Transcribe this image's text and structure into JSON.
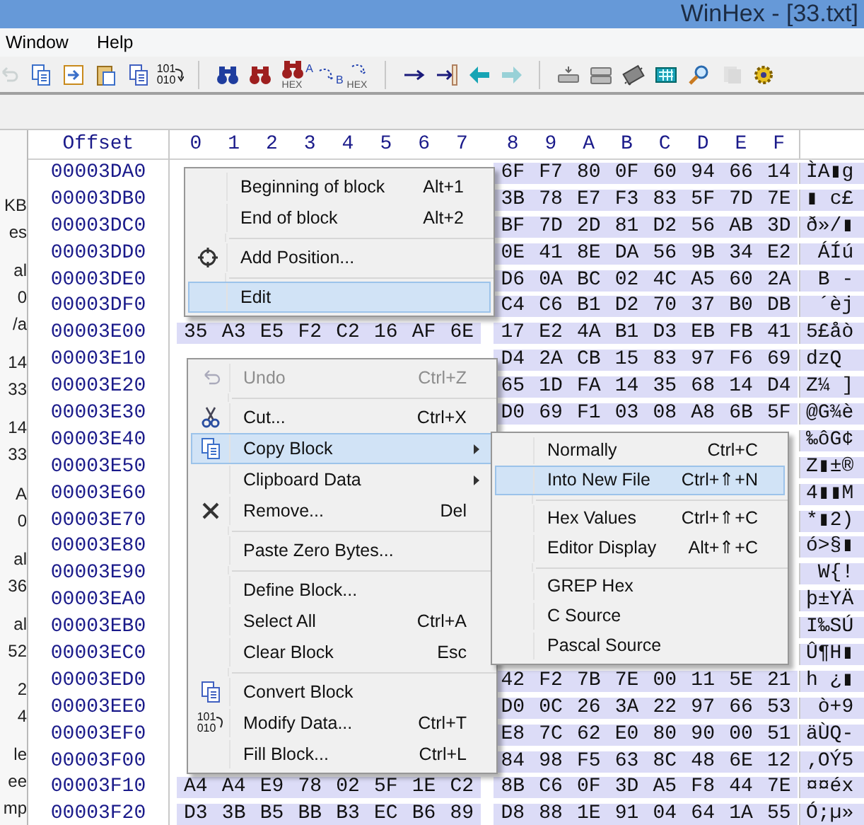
{
  "window": {
    "title": "WinHex - [33.txt]"
  },
  "menu_bar": [
    "Window",
    "Help"
  ],
  "toolbar": [
    {
      "tools": [
        {
          "kind": "undo",
          "disabled": true
        },
        {
          "kind": "copy",
          "disabled": false
        },
        {
          "kind": "paste",
          "disabled": false
        },
        {
          "kind": "clipboard",
          "disabled": false
        },
        {
          "kind": "convert",
          "disabled": false
        },
        {
          "kind": "bits",
          "disabled": false,
          "caption": [
            "101",
            "010"
          ]
        }
      ]
    },
    {
      "tools": [
        {
          "kind": "find",
          "disabled": false
        },
        {
          "kind": "find-red",
          "disabled": false
        },
        {
          "kind": "find-hex",
          "disabled": false,
          "caption": [
            "HEX"
          ]
        },
        {
          "kind": "replace",
          "disabled": false,
          "caption": [
            "A",
            "B"
          ]
        },
        {
          "kind": "replace-hex",
          "disabled": false,
          "caption": [
            "HEX"
          ]
        }
      ]
    },
    {
      "tools": [
        {
          "kind": "goto",
          "disabled": false
        },
        {
          "kind": "goto-mark",
          "disabled": false
        },
        {
          "kind": "back",
          "disabled": false
        },
        {
          "kind": "forward",
          "disabled": true
        }
      ]
    },
    {
      "tools": [
        {
          "kind": "disk",
          "disabled": false
        },
        {
          "kind": "disks",
          "disabled": false
        },
        {
          "kind": "chip",
          "disabled": false
        },
        {
          "kind": "calc",
          "disabled": false
        },
        {
          "kind": "zoom",
          "disabled": false
        },
        {
          "kind": "cards",
          "disabled": true
        },
        {
          "kind": "gear",
          "disabled": false
        }
      ]
    }
  ],
  "side_panel": [
    [
      "KB",
      "es"
    ],
    [
      "al",
      "0",
      "/a"
    ],
    [
      "14",
      "33"
    ],
    [
      "14",
      "33"
    ],
    [
      "A",
      "0"
    ],
    [
      "al",
      "36"
    ],
    [
      "al",
      "52"
    ],
    [
      "2",
      "4"
    ],
    [
      "le",
      "ee",
      "mp"
    ]
  ],
  "grid": {
    "offset_header": "Offset",
    "columns": [
      "0",
      "1",
      "2",
      "3",
      "4",
      "5",
      "6",
      "7",
      "8",
      "9",
      "A",
      "B",
      "C",
      "D",
      "E",
      "F"
    ],
    "rows": [
      {
        "offset": "00003DA0",
        "high": [
          "6F",
          "F7",
          "80",
          "0F",
          "60",
          "94",
          "66",
          "14"
        ],
        "text": "ÌA▮g"
      },
      {
        "offset": "00003DB0",
        "high": [
          "3B",
          "78",
          "E7",
          "F3",
          "83",
          "5F",
          "7D",
          "7E"
        ],
        "text": "▮ c£"
      },
      {
        "offset": "00003DC0",
        "high": [
          "BF",
          "7D",
          "2D",
          "81",
          "D2",
          "56",
          "AB",
          "3D"
        ],
        "text": "ð»/▮"
      },
      {
        "offset": "00003DD0",
        "high": [
          "0E",
          "41",
          "8E",
          "DA",
          "56",
          "9B",
          "34",
          "E2"
        ],
        "text": " ÁÍú"
      },
      {
        "offset": "00003DE0",
        "high": [
          "D6",
          "0A",
          "BC",
          "02",
          "4C",
          "A5",
          "60",
          "2A"
        ],
        "text": " B -"
      },
      {
        "offset": "00003DF0",
        "high": [
          "C4",
          "C6",
          "B1",
          "D2",
          "70",
          "37",
          "B0",
          "DB"
        ],
        "text": " ´èj"
      },
      {
        "offset": "00003E00",
        "low": [
          "35",
          "A3",
          "E5",
          "F2",
          "C2",
          "16",
          "AF",
          "6E"
        ],
        "high": [
          "17",
          "E2",
          "4A",
          "B1",
          "D3",
          "EB",
          "FB",
          "41"
        ],
        "text": "5£åò"
      },
      {
        "offset": "00003E10",
        "high": [
          "D4",
          "2A",
          "CB",
          "15",
          "83",
          "97",
          "F6",
          "69"
        ],
        "text": "dzQ"
      },
      {
        "offset": "00003E20",
        "high": [
          "65",
          "1D",
          "FA",
          "14",
          "35",
          "68",
          "14",
          "D4"
        ],
        "text": "Z¼ ]"
      },
      {
        "offset": "00003E30",
        "high": [
          "D0",
          "69",
          "F1",
          "03",
          "08",
          "A8",
          "6B",
          "5F"
        ],
        "text": "@G¾è"
      },
      {
        "offset": "00003E40",
        "text": "‰ôG¢"
      },
      {
        "offset": "00003E50",
        "text": "Z▮±®"
      },
      {
        "offset": "00003E60",
        "text": "4▮▮M"
      },
      {
        "offset": "00003E70",
        "text": "*▮2)"
      },
      {
        "offset": "00003E80",
        "text": "ó>§▮"
      },
      {
        "offset": "00003E90",
        "text": " W{!"
      },
      {
        "offset": "00003EA0",
        "text": "þ±YÄ"
      },
      {
        "offset": "00003EB0",
        "text": "I‰SÚ"
      },
      {
        "offset": "00003EC0",
        "text": "Û¶H▮"
      },
      {
        "offset": "00003ED0",
        "high": [
          "42",
          "F2",
          "7B",
          "7E",
          "00",
          "11",
          "5E",
          "21"
        ],
        "text": "h ¿▮"
      },
      {
        "offset": "00003EE0",
        "high": [
          "D0",
          "0C",
          "26",
          "3A",
          "22",
          "97",
          "66",
          "53"
        ],
        "text": " ò+9"
      },
      {
        "offset": "00003EF0",
        "high": [
          "E8",
          "7C",
          "62",
          "E0",
          "80",
          "90",
          "00",
          "51"
        ],
        "text": "äÙQ-"
      },
      {
        "offset": "00003F00",
        "high": [
          "84",
          "98",
          "F5",
          "63",
          "8C",
          "48",
          "6E",
          "12"
        ],
        "text": "‚OÝ5"
      },
      {
        "offset": "00003F10",
        "low": [
          "A4",
          "A4",
          "E9",
          "78",
          "02",
          "5F",
          "1E",
          "C2"
        ],
        "high": [
          "8B",
          "C6",
          "0F",
          "3D",
          "A5",
          "F8",
          "44",
          "7E"
        ],
        "text": "¤¤éx"
      },
      {
        "offset": "00003F20",
        "low": [
          "D3",
          "3B",
          "B5",
          "BB",
          "B3",
          "EC",
          "B6",
          "89"
        ],
        "high": [
          "D8",
          "88",
          "1E",
          "91",
          "04",
          "64",
          "1A",
          "55"
        ],
        "text": "Ó;µ»"
      }
    ]
  },
  "menus": [
    {
      "items": [
        {
          "kind": "item",
          "label": "Beginning of block",
          "shortcut": "Alt+1",
          "selected": false,
          "disabled": false,
          "submenu": false
        },
        {
          "kind": "item",
          "label": "End of block",
          "shortcut": "Alt+2",
          "selected": false,
          "disabled": false,
          "submenu": false
        },
        {
          "kind": "separator"
        },
        {
          "kind": "item",
          "label": "Add Position...",
          "selected": false,
          "disabled": false,
          "submenu": false
        },
        {
          "kind": "separator"
        },
        {
          "kind": "item",
          "label": "Edit",
          "selected": true,
          "disabled": false,
          "submenu": false
        }
      ]
    },
    {
      "items": [
        {
          "kind": "item",
          "label": "Undo",
          "shortcut": "Ctrl+Z",
          "selected": false,
          "disabled": true,
          "submenu": false
        },
        {
          "kind": "separator"
        },
        {
          "kind": "item",
          "label": "Cut...",
          "shortcut": "Ctrl+X",
          "selected": false,
          "disabled": false,
          "submenu": false
        },
        {
          "kind": "item",
          "label": "Copy Block",
          "selected": true,
          "disabled": false,
          "submenu": true
        },
        {
          "kind": "item",
          "label": "Clipboard Data",
          "selected": false,
          "disabled": false,
          "submenu": true
        },
        {
          "kind": "item",
          "label": "Remove...",
          "shortcut": "Del",
          "selected": false,
          "disabled": false,
          "submenu": false
        },
        {
          "kind": "separator"
        },
        {
          "kind": "item",
          "label": "Paste Zero Bytes...",
          "selected": false,
          "disabled": false,
          "submenu": false
        },
        {
          "kind": "separator"
        },
        {
          "kind": "item",
          "label": "Define Block...",
          "selected": false,
          "disabled": false,
          "submenu": false
        },
        {
          "kind": "item",
          "label": "Select All",
          "shortcut": "Ctrl+A",
          "selected": false,
          "disabled": false,
          "submenu": false
        },
        {
          "kind": "item",
          "label": "Clear Block",
          "shortcut": "Esc",
          "selected": false,
          "disabled": false,
          "submenu": false
        },
        {
          "kind": "separator"
        },
        {
          "kind": "item",
          "label": "Convert Block",
          "selected": false,
          "disabled": false,
          "submenu": false
        },
        {
          "kind": "item",
          "label": "Modify Data...",
          "shortcut": "Ctrl+T",
          "selected": false,
          "disabled": false,
          "submenu": false,
          "icon_caption": [
            "101",
            "010"
          ]
        },
        {
          "kind": "item",
          "label": "Fill Block...",
          "shortcut": "Ctrl+L",
          "selected": false,
          "disabled": false,
          "submenu": false
        }
      ]
    },
    {
      "items": [
        {
          "kind": "item",
          "label": "Normally",
          "shortcut": "Ctrl+C",
          "selected": false,
          "disabled": false,
          "submenu": false
        },
        {
          "kind": "item",
          "label": "Into New File",
          "shortcut": "Ctrl+⇑+N",
          "selected": true,
          "disabled": false,
          "submenu": false
        },
        {
          "kind": "separator"
        },
        {
          "kind": "item",
          "label": "Hex Values",
          "shortcut": "Ctrl+⇑+C",
          "selected": false,
          "disabled": false,
          "submenu": false
        },
        {
          "kind": "item",
          "label": "Editor Display",
          "shortcut": "Alt+⇑+C",
          "selected": false,
          "disabled": false,
          "submenu": false
        },
        {
          "kind": "separator"
        },
        {
          "kind": "item",
          "label": "GREP Hex",
          "selected": false,
          "disabled": false,
          "submenu": false
        },
        {
          "kind": "item",
          "label": "C Source",
          "selected": false,
          "disabled": false,
          "submenu": false
        },
        {
          "kind": "item",
          "label": "Pascal Source",
          "selected": false,
          "disabled": false,
          "submenu": false
        }
      ]
    }
  ]
}
